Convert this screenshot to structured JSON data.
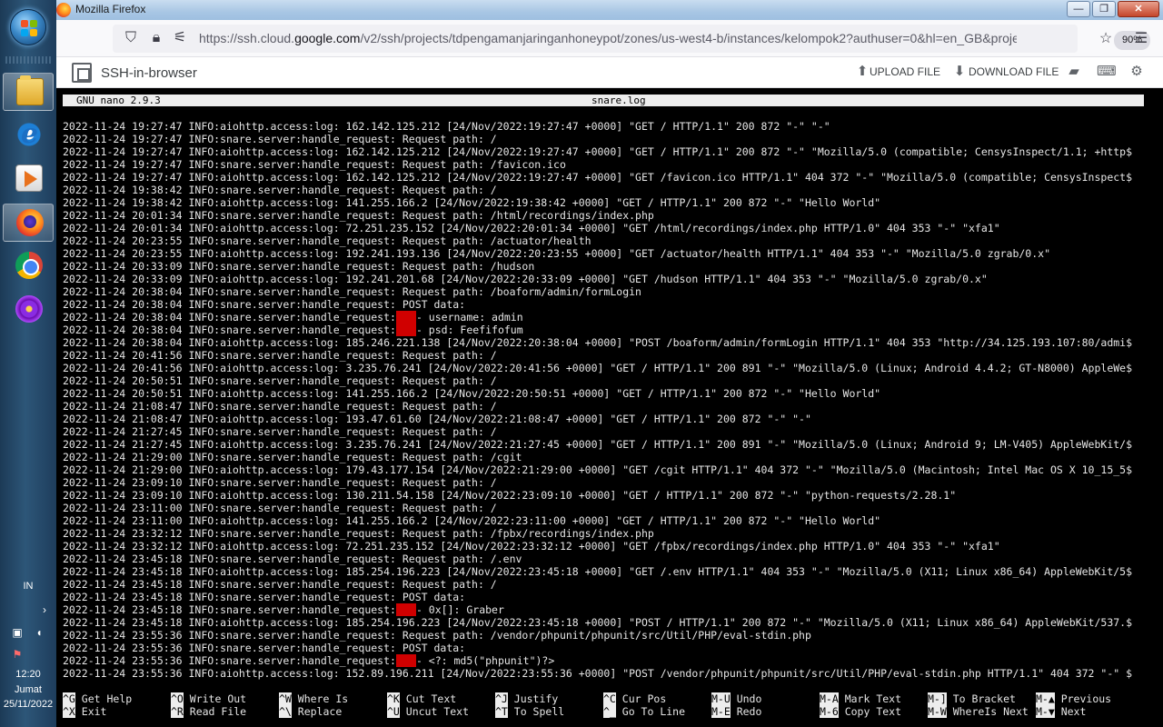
{
  "taskbar": {
    "lang": "IN",
    "time": "12:20",
    "day": "Jumat",
    "date": "25/11/2022"
  },
  "window": {
    "title": "Mozilla Firefox"
  },
  "navbar": {
    "url_prefix": "https://ssh.cloud.",
    "url_domain": "google.com",
    "url_path": "/v2/ssh/projects/tdpengamanjaringanhoneypot/zones/us-west4-b/instances/kelompok2?authuser=0&hl=en_GB&projectNumber=872",
    "zoom": "90%"
  },
  "ssh": {
    "title": "SSH-in-browser",
    "upload": "UPLOAD FILE",
    "download": "DOWNLOAD FILE"
  },
  "nano": {
    "version": "GNU nano 2.9.3",
    "filename": "snare.log"
  },
  "log_lines": [
    "2022-11-24 19:27:47 INFO:aiohttp.access:log: 162.142.125.212 [24/Nov/2022:19:27:47 +0000] \"GET / HTTP/1.1\" 200 872 \"-\" \"-\"",
    "2022-11-24 19:27:47 INFO:snare.server:handle_request: Request path: /",
    "2022-11-24 19:27:47 INFO:aiohttp.access:log: 162.142.125.212 [24/Nov/2022:19:27:47 +0000] \"GET / HTTP/1.1\" 200 872 \"-\" \"Mozilla/5.0 (compatible; CensysInspect/1.1; +http$",
    "2022-11-24 19:27:47 INFO:snare.server:handle_request: Request path: /favicon.ico",
    "2022-11-24 19:27:47 INFO:aiohttp.access:log: 162.142.125.212 [24/Nov/2022:19:27:47 +0000] \"GET /favicon.ico HTTP/1.1\" 404 372 \"-\" \"Mozilla/5.0 (compatible; CensysInspect$",
    "2022-11-24 19:38:42 INFO:snare.server:handle_request: Request path: /",
    "2022-11-24 19:38:42 INFO:aiohttp.access:log: 141.255.166.2 [24/Nov/2022:19:38:42 +0000] \"GET / HTTP/1.1\" 200 872 \"-\" \"Hello World\"",
    "2022-11-24 20:01:34 INFO:snare.server:handle_request: Request path: /html/recordings/index.php",
    "2022-11-24 20:01:34 INFO:aiohttp.access:log: 72.251.235.152 [24/Nov/2022:20:01:34 +0000] \"GET /html/recordings/index.php HTTP/1.0\" 404 353 \"-\" \"xfa1\"",
    "2022-11-24 20:23:55 INFO:snare.server:handle_request: Request path: /actuator/health",
    "2022-11-24 20:23:55 INFO:aiohttp.access:log: 192.241.193.136 [24/Nov/2022:20:23:55 +0000] \"GET /actuator/health HTTP/1.1\" 404 353 \"-\" \"Mozilla/5.0 zgrab/0.x\"",
    "2022-11-24 20:33:09 INFO:snare.server:handle_request: Request path: /hudson",
    "2022-11-24 20:33:09 INFO:aiohttp.access:log: 192.241.201.68 [24/Nov/2022:20:33:09 +0000] \"GET /hudson HTTP/1.1\" 404 353 \"-\" \"Mozilla/5.0 zgrab/0.x\"",
    "2022-11-24 20:38:04 INFO:snare.server:handle_request: Request path: /boaform/admin/formLogin",
    "2022-11-24 20:38:04 INFO:snare.server:handle_request: POST data:",
    "2022-11-24 20:38:04 INFO:snare.server:handle_request:\u0001- username: admin",
    "2022-11-24 20:38:04 INFO:snare.server:handle_request:\u0001- psd: Feefifofum",
    "2022-11-24 20:38:04 INFO:aiohttp.access:log: 185.246.221.138 [24/Nov/2022:20:38:04 +0000] \"POST /boaform/admin/formLogin HTTP/1.1\" 404 353 \"http://34.125.193.107:80/admi$",
    "2022-11-24 20:41:56 INFO:snare.server:handle_request: Request path: /",
    "2022-11-24 20:41:56 INFO:aiohttp.access:log: 3.235.76.241 [24/Nov/2022:20:41:56 +0000] \"GET / HTTP/1.1\" 200 891 \"-\" \"Mozilla/5.0 (Linux; Android 4.4.2; GT-N8000) AppleWe$",
    "2022-11-24 20:50:51 INFO:snare.server:handle_request: Request path: /",
    "2022-11-24 20:50:51 INFO:aiohttp.access:log: 141.255.166.2 [24/Nov/2022:20:50:51 +0000] \"GET / HTTP/1.1\" 200 872 \"-\" \"Hello World\"",
    "2022-11-24 21:08:47 INFO:snare.server:handle_request: Request path: /",
    "2022-11-24 21:08:47 INFO:aiohttp.access:log: 193.47.61.60 [24/Nov/2022:21:08:47 +0000] \"GET / HTTP/1.1\" 200 872 \"-\" \"-\"",
    "2022-11-24 21:27:45 INFO:snare.server:handle_request: Request path: /",
    "2022-11-24 21:27:45 INFO:aiohttp.access:log: 3.235.76.241 [24/Nov/2022:21:27:45 +0000] \"GET / HTTP/1.1\" 200 891 \"-\" \"Mozilla/5.0 (Linux; Android 9; LM-V405) AppleWebKit/$",
    "2022-11-24 21:29:00 INFO:snare.server:handle_request: Request path: /cgit",
    "2022-11-24 21:29:00 INFO:aiohttp.access:log: 179.43.177.154 [24/Nov/2022:21:29:00 +0000] \"GET /cgit HTTP/1.1\" 404 372 \"-\" \"Mozilla/5.0 (Macintosh; Intel Mac OS X 10_15_5$",
    "2022-11-24 23:09:10 INFO:snare.server:handle_request: Request path: /",
    "2022-11-24 23:09:10 INFO:aiohttp.access:log: 130.211.54.158 [24/Nov/2022:23:09:10 +0000] \"GET / HTTP/1.1\" 200 872 \"-\" \"python-requests/2.28.1\"",
    "2022-11-24 23:11:00 INFO:snare.server:handle_request: Request path: /",
    "2022-11-24 23:11:00 INFO:aiohttp.access:log: 141.255.166.2 [24/Nov/2022:23:11:00 +0000] \"GET / HTTP/1.1\" 200 872 \"-\" \"Hello World\"",
    "2022-11-24 23:32:12 INFO:snare.server:handle_request: Request path: /fpbx/recordings/index.php",
    "2022-11-24 23:32:12 INFO:aiohttp.access:log: 72.251.235.152 [24/Nov/2022:23:32:12 +0000] \"GET /fpbx/recordings/index.php HTTP/1.0\" 404 353 \"-\" \"xfa1\"",
    "2022-11-24 23:45:18 INFO:snare.server:handle_request: Request path: /.env",
    "2022-11-24 23:45:18 INFO:aiohttp.access:log: 185.254.196.223 [24/Nov/2022:23:45:18 +0000] \"GET /.env HTTP/1.1\" 404 353 \"-\" \"Mozilla/5.0 (X11; Linux x86_64) AppleWebKit/5$",
    "2022-11-24 23:45:18 INFO:snare.server:handle_request: Request path: /",
    "2022-11-24 23:45:18 INFO:snare.server:handle_request: POST data:",
    "2022-11-24 23:45:18 INFO:snare.server:handle_request:\u0001- 0x[]: Graber",
    "2022-11-24 23:45:18 INFO:aiohttp.access:log: 185.254.196.223 [24/Nov/2022:23:45:18 +0000] \"POST / HTTP/1.1\" 200 872 \"-\" \"Mozilla/5.0 (X11; Linux x86_64) AppleWebKit/537.$",
    "2022-11-24 23:55:36 INFO:snare.server:handle_request: Request path: /vendor/phpunit/phpunit/src/Util/PHP/eval-stdin.php",
    "2022-11-24 23:55:36 INFO:snare.server:handle_request: POST data:",
    "2022-11-24 23:55:36 INFO:snare.server:handle_request:\u0001- <?: md5(\"phpunit\")?>",
    "2022-11-24 23:55:36 INFO:aiohttp.access:log: 152.89.196.211 [24/Nov/2022:23:55:36 +0000] \"POST /vendor/phpunit/phpunit/src/Util/PHP/eval-stdin.php HTTP/1.1\" 404 372 \"-\" $"
  ],
  "shortcuts": [
    {
      "key": "^G",
      "label": "Get Help"
    },
    {
      "key": "^X",
      "label": "Exit"
    },
    {
      "key": "^O",
      "label": "Write Out"
    },
    {
      "key": "^R",
      "label": "Read File"
    },
    {
      "key": "^W",
      "label": "Where Is"
    },
    {
      "key": "^\\",
      "label": "Replace"
    },
    {
      "key": "^K",
      "label": "Cut Text"
    },
    {
      "key": "^U",
      "label": "Uncut Text"
    },
    {
      "key": "^J",
      "label": "Justify"
    },
    {
      "key": "^T",
      "label": "To Spell"
    },
    {
      "key": "^C",
      "label": "Cur Pos"
    },
    {
      "key": "^_",
      "label": "Go To Line"
    },
    {
      "key": "M-U",
      "label": "Undo"
    },
    {
      "key": "M-E",
      "label": "Redo"
    },
    {
      "key": "M-A",
      "label": "Mark Text"
    },
    {
      "key": "M-6",
      "label": "Copy Text"
    },
    {
      "key": "M-]",
      "label": "To Bracket"
    },
    {
      "key": "M-W",
      "label": "WhereIs Next"
    },
    {
      "key": "M-▲",
      "label": "Previous"
    },
    {
      "key": "M-▼",
      "label": "Next"
    }
  ],
  "colors": {
    "terminal_bg": "#000000",
    "terminal_fg": "#e6e6e6",
    "redaction": "#d00000",
    "nano_bar": "#ededed"
  }
}
